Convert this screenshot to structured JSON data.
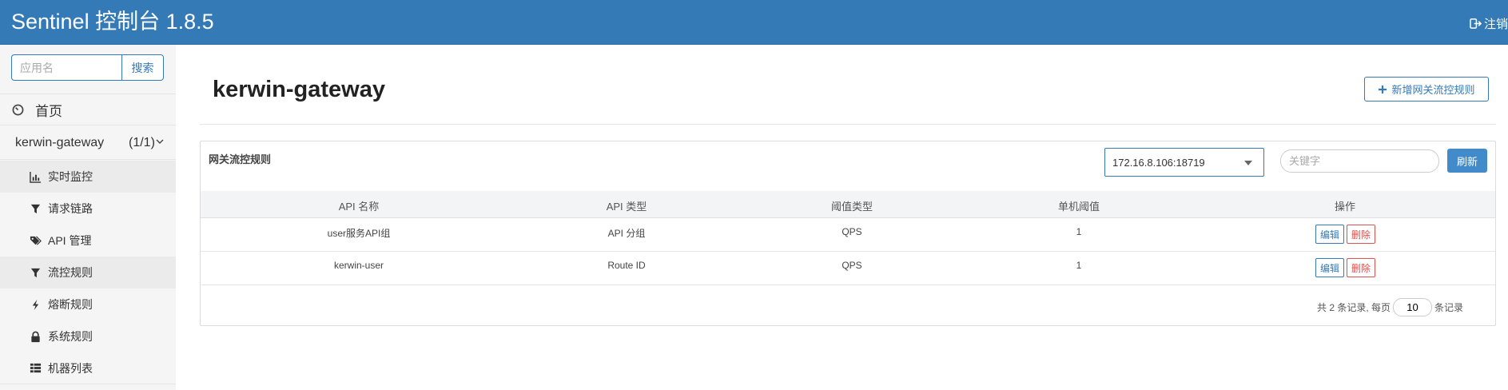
{
  "header": {
    "brand": "Sentinel 控制台 1.8.5",
    "logout_label": "注销"
  },
  "sidebar": {
    "search_placeholder": "应用名",
    "search_button": "搜索",
    "home_label": "首页",
    "app": {
      "name": "kerwin-gateway",
      "count": "(1/1)"
    },
    "menu": [
      {
        "label": "实时监控",
        "icon": "bar-chart-icon"
      },
      {
        "label": "请求链路",
        "icon": "filter-icon"
      },
      {
        "label": "API 管理",
        "icon": "tags-icon"
      },
      {
        "label": "流控规则",
        "icon": "filter-icon"
      },
      {
        "label": "熔断规则",
        "icon": "flash-icon"
      },
      {
        "label": "系统规则",
        "icon": "lock-icon"
      },
      {
        "label": "机器列表",
        "icon": "th-list-icon"
      }
    ]
  },
  "main": {
    "title": "kerwin-gateway",
    "add_button": "新增网关流控规则",
    "panel_title": "网关流控规则",
    "machine_selected": "172.16.8.106:18719",
    "keyword_placeholder": "关键字",
    "refresh_button": "刷新",
    "table": {
      "headers": [
        "API 名称",
        "API 类型",
        "阈值类型",
        "单机阈值",
        "操作"
      ],
      "rows": [
        {
          "api_name": "user服务API组",
          "api_type": "API 分组",
          "threshold_type": "QPS",
          "threshold": "1"
        },
        {
          "api_name": "kerwin-user",
          "api_type": "Route ID",
          "threshold_type": "QPS",
          "threshold": "1"
        }
      ],
      "edit_label": "编辑",
      "delete_label": "删除"
    },
    "pager": {
      "summary_prefix": "共 2 条记录, 每页",
      "page_size": "10",
      "summary_suffix": "条记录"
    }
  },
  "colors": {
    "primary": "#337ab7",
    "danger": "#d9534f",
    "refresh": "#428bca"
  }
}
